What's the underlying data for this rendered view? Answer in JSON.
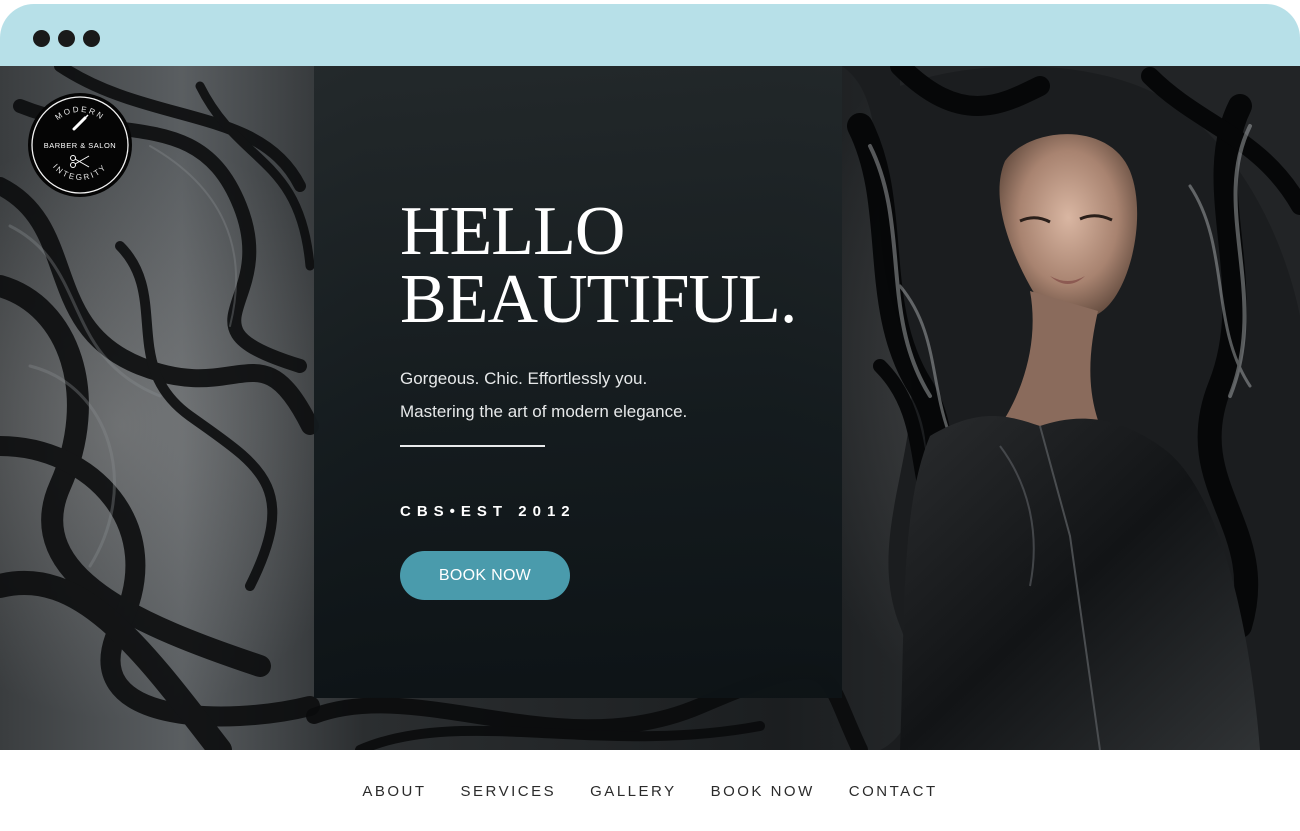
{
  "browser": {
    "window_controls": [
      "dot",
      "dot",
      "dot"
    ]
  },
  "logo": {
    "top_text": "MODERN",
    "middle_text": "BARBER & SALON",
    "bottom_text": "INTEGRITY",
    "icons": [
      "razor-icon",
      "scissors-icon"
    ]
  },
  "hero": {
    "headline_line1": "HELLO",
    "headline_line2": "BEAUTIFUL.",
    "tagline_line1": "Gorgeous. Chic. Effortlessly you.",
    "tagline_line2": "Mastering the art of modern elegance.",
    "est_text": "CBS•EST 2012",
    "cta_label": "BOOK NOW",
    "cta_color": "#4a9bac"
  },
  "nav": {
    "items": [
      {
        "label": "ABOUT"
      },
      {
        "label": "SERVICES"
      },
      {
        "label": "GALLERY"
      },
      {
        "label": "BOOK NOW"
      },
      {
        "label": "CONTACT"
      }
    ]
  },
  "colors": {
    "chrome_bar": "#b7e0e8",
    "panel": "#141b1e",
    "accent": "#4a9bac"
  }
}
